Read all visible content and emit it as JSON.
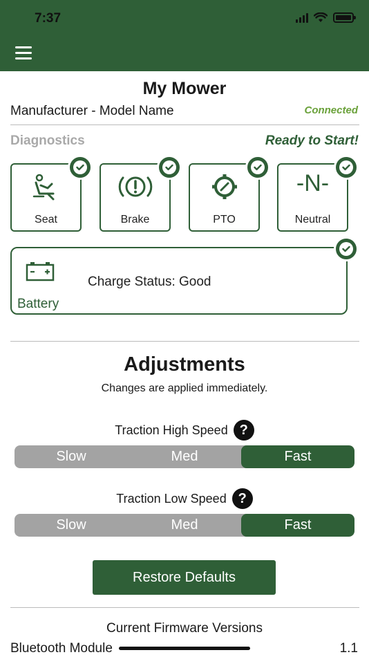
{
  "status_bar": {
    "time": "7:37"
  },
  "header": {
    "menu_icon": "hamburger-menu-icon"
  },
  "page_title": "My Mower",
  "device": {
    "model": "Manufacturer - Model Name",
    "connection": "Connected"
  },
  "diagnostics": {
    "label": "Diagnostics",
    "status": "Ready to Start!",
    "tiles": [
      {
        "label": "Seat",
        "icon": "seat-icon",
        "ok": true
      },
      {
        "label": "Brake",
        "icon": "brake-warning-icon",
        "ok": true
      },
      {
        "label": "PTO",
        "icon": "pto-gear-icon",
        "ok": true
      },
      {
        "label": "Neutral",
        "icon": "neutral-icon",
        "glyph": "-N-",
        "ok": true
      }
    ],
    "battery": {
      "label": "Battery",
      "charge_status": "Charge Status: Good",
      "icon": "car-battery-icon",
      "ok": true
    }
  },
  "adjustments": {
    "title": "Adjustments",
    "subtitle": "Changes are applied immediately.",
    "settings": [
      {
        "label": "Traction High Speed",
        "options": [
          "Slow",
          "Med",
          "Fast"
        ],
        "selected": "Fast"
      },
      {
        "label": "Traction Low Speed",
        "options": [
          "Slow",
          "Med",
          "Fast"
        ],
        "selected": "Fast"
      }
    ],
    "restore_label": "Restore Defaults"
  },
  "firmware": {
    "title": "Current Firmware Versions",
    "items": [
      {
        "name": "Bluetooth Module",
        "version": "1.1"
      }
    ]
  },
  "colors": {
    "primary": "#2f5f37",
    "connected": "#6aa13a",
    "segment_bg": "#a3a3a3"
  }
}
